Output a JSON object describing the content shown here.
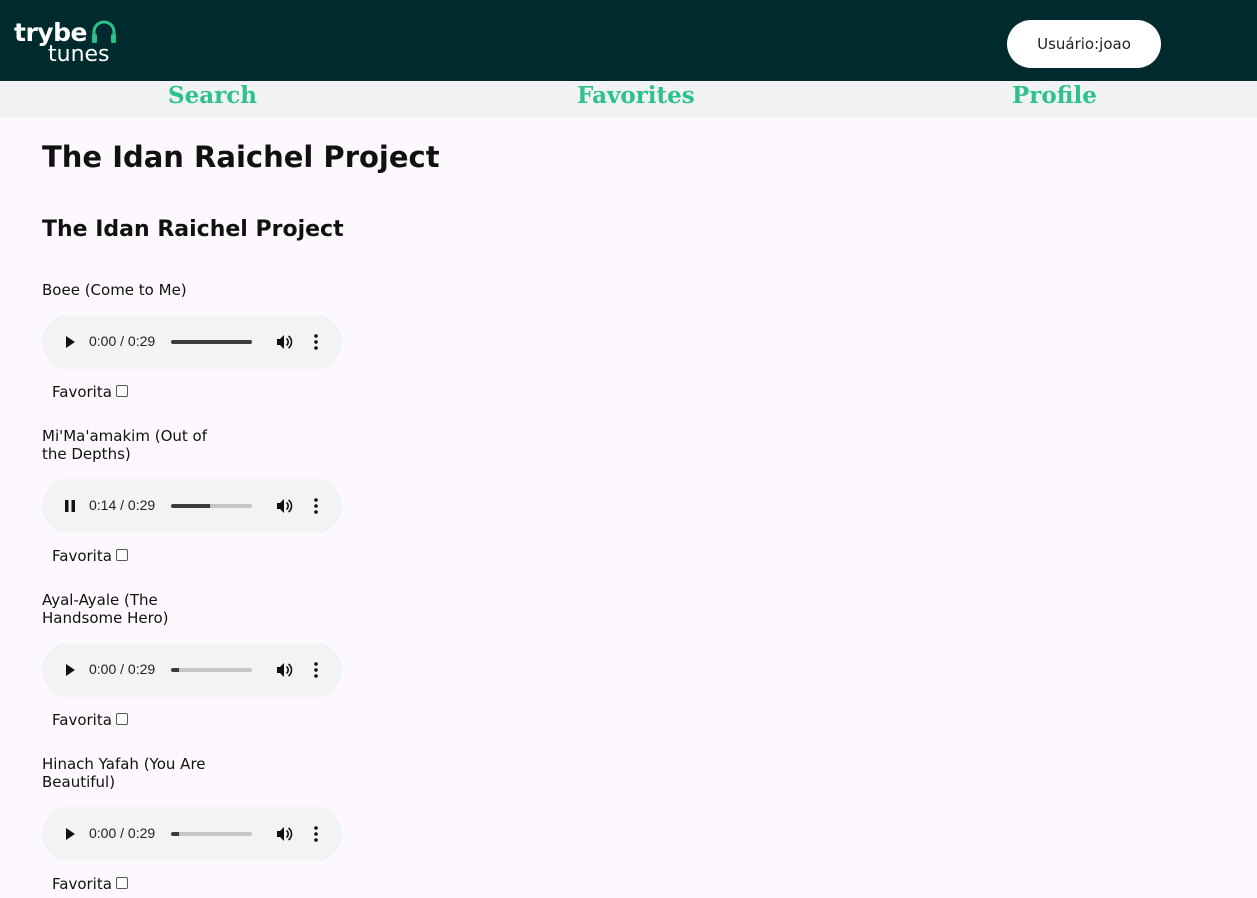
{
  "header": {
    "logo_word_1": "trybe",
    "logo_word_2": "tunes",
    "logo_icon": "headphones-icon",
    "user_label": "Usuário:joao"
  },
  "nav": {
    "search": "Search",
    "favorites": "Favorites",
    "profile": "Profile"
  },
  "artist": "The Idan Raichel Project",
  "album": "The Idan Raichel Project",
  "colors": {
    "header_bg": "#002b2e",
    "nav_link": "#2fc18c",
    "nav_bg": "#f0f2f4",
    "page_bg": "#fdf8fd"
  },
  "tracks": [
    {
      "name": "Boee (Come to Me)",
      "time": "0:00 / 0:29",
      "state": "paused",
      "progress": 1.0,
      "favorite_label": "Favorita",
      "favorite": false
    },
    {
      "name": "Mi'Ma'amakim (Out of the Depths)",
      "time": "0:14 / 0:29",
      "state": "playing",
      "progress": 0.48,
      "favorite_label": "Favorita",
      "favorite": false
    },
    {
      "name": "Ayal-Ayale (The Handsome Hero)",
      "time": "0:00 / 0:29",
      "state": "paused",
      "progress": 0.1,
      "favorite_label": "Favorita",
      "favorite": false
    },
    {
      "name": "Hinach Yafah (You Are Beautiful)",
      "time": "0:00 / 0:29",
      "state": "paused",
      "progress": 0.1,
      "favorite_label": "Favorita",
      "favorite": false
    }
  ]
}
